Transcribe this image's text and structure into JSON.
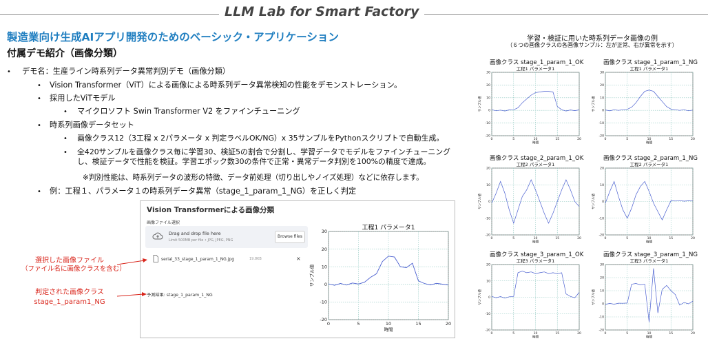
{
  "header": {
    "title": "LLM Lab for Smart Factory"
  },
  "main_title": "製造業向け生成AIアプリ開発のためのベーシック・アプリケーション",
  "sub_title": "付属デモ紹介（画像分類）",
  "bullets": {
    "demo": "デモ名：生産ライン時系列データ異常判別デモ（画像分類）",
    "vit": "Vision Transformer（ViT）による画像による時系列データ異常検知の性能をデモンストレーション。",
    "model_head": "採用したViTモデル",
    "model": "マイクロソフト Swin Transformer V2 をファインチューニング",
    "dataset_head": "時系列画像データセット",
    "classes": "画像クラス12（3工程 x 2パラメータ x 判定ラベルOK/NG）x 35サンプルをPythonスクリプトで自動生成。",
    "train1": "全420サンプルを画像クラス毎に学習30、検証5の割合で分割し、学習データでモデルをファインチューニング",
    "train2": "し、検証データで性能を検証。学習エポック数30の条件で正常・異常データ判別を100%の精度で達成。",
    "note": "※判別性能は、時系列データの波形の特徴、データ前処理（切り出しやノイズ処理）などに依存します。",
    "example": "例：工程１、パラメータ１の時系列データ異常（stage_1_param_1_NG）を正しく判定"
  },
  "app": {
    "title": "Vision Transformerによる画像分類",
    "upload_label": "画像ファイル選択",
    "drop_main": "Drag and drop file here",
    "drop_sub": "Limit 500MB per file • JPG, JPEG, PNG",
    "browse": "Browse files",
    "file_name": "serial_33_stage_1_param_1_NG.jpg",
    "file_size": "19.8KB",
    "close": "×",
    "prediction": "予測結果: stage_1_param_1_NG"
  },
  "annotations": {
    "file_line1": "選択した画像ファイル",
    "file_line2": "（ファイル名に画像クラスを含む）",
    "class_line1": "判定された画像クラス",
    "class_line2": "stage_1_param1_NG"
  },
  "right_panel": {
    "title": "学習・検証に用いた時系列データ画像の例",
    "subtitle": "（６つの画像クラスの各画像サンプル：左が正常、右が異常を示す）"
  },
  "chart_data": [
    {
      "type": "line",
      "label": "",
      "title": "工程1 パラメータ1",
      "xlabel": "時間",
      "ylabel": "サンプル値",
      "xlim": [
        0,
        20
      ],
      "ylim": [
        -20,
        30
      ],
      "xticks": [
        0,
        5,
        10,
        15,
        20
      ],
      "yticks": [
        -20,
        -10,
        0,
        10,
        20,
        30
      ],
      "grid": true,
      "x": [
        0,
        1,
        2,
        3,
        4,
        5,
        6,
        7,
        8,
        9,
        10,
        11,
        12,
        13,
        14,
        15,
        16,
        17,
        18,
        19,
        20
      ],
      "values": [
        0.3,
        -0.5,
        0.5,
        -0.4,
        0.8,
        0.2,
        1.2,
        4,
        6,
        13,
        16,
        15.5,
        10,
        9.5,
        12,
        2,
        0.5,
        -0.3,
        0.6,
        0.1,
        -0.4
      ]
    },
    {
      "type": "line",
      "label": "画像クラス stage_1_param_1_OK",
      "title": "工程1 パラメータ1",
      "xlabel": "時間",
      "ylabel": "サンプル値",
      "xlim": [
        0,
        20
      ],
      "ylim": [
        -20,
        30
      ],
      "xticks": [
        0,
        5,
        10,
        15,
        20
      ],
      "yticks": [
        -20,
        -10,
        0,
        10,
        20,
        30
      ],
      "grid": true,
      "x": [
        0,
        1,
        2,
        3,
        4,
        5,
        6,
        7,
        8,
        9,
        10,
        11,
        12,
        13,
        14,
        15,
        16,
        17,
        18,
        19,
        20
      ],
      "values": [
        0.5,
        -0.3,
        0.2,
        -0.5,
        0.4,
        0.5,
        2,
        6,
        9,
        12,
        14,
        14.5,
        15,
        15,
        14.5,
        3,
        0.5,
        -0.5,
        0.3,
        -0.2,
        0.4
      ]
    },
    {
      "type": "line",
      "label": "画像クラス stage_1_param_1_NG",
      "title": "工程1 パラメータ1",
      "xlabel": "時間",
      "ylabel": "サンプル値",
      "xlim": [
        0,
        20
      ],
      "ylim": [
        -20,
        30
      ],
      "xticks": [
        0,
        5,
        10,
        15,
        20
      ],
      "yticks": [
        -20,
        -10,
        0,
        10,
        20,
        30
      ],
      "grid": true,
      "x": [
        0,
        1,
        2,
        3,
        4,
        5,
        6,
        7,
        8,
        9,
        10,
        11,
        12,
        13,
        14,
        15,
        16,
        17,
        18,
        19,
        20
      ],
      "values": [
        0.3,
        -0.4,
        0.5,
        0,
        0.5,
        0.8,
        2.5,
        6,
        11,
        15,
        16,
        15,
        11,
        7,
        3,
        1,
        0.5,
        0,
        0.5,
        -0.3,
        0.2
      ]
    },
    {
      "type": "line",
      "label": "画像クラス stage_2_param_1_OK",
      "title": "工程2 パラメータ1",
      "xlabel": "時間",
      "ylabel": "サンプル値",
      "xlim": [
        0,
        20
      ],
      "ylim": [
        -20,
        20
      ],
      "xticks": [
        0,
        5,
        10,
        15,
        20
      ],
      "yticks": [
        -20,
        -10,
        0,
        10,
        20
      ],
      "grid": true,
      "x": [
        0,
        1,
        2,
        3,
        4,
        5,
        6,
        7,
        8,
        9,
        10,
        11,
        12,
        13,
        14,
        15,
        16,
        17,
        18,
        19,
        20
      ],
      "values": [
        -1,
        5,
        12,
        5,
        -5,
        -13,
        -5,
        3,
        7,
        13,
        7,
        0,
        -7,
        -13,
        -7,
        0,
        7,
        13,
        7,
        0,
        -3
      ]
    },
    {
      "type": "line",
      "label": "画像クラス stage_2_param_1_NG",
      "title": "工程2 パラメータ1",
      "xlabel": "時間",
      "ylabel": "サンプル値",
      "xlim": [
        0,
        20
      ],
      "ylim": [
        -20,
        20
      ],
      "xticks": [
        0,
        5,
        10,
        15,
        20
      ],
      "yticks": [
        -20,
        -10,
        0,
        10,
        20
      ],
      "grid": true,
      "x": [
        0,
        1,
        2,
        3,
        4,
        5,
        6,
        7,
        8,
        9,
        10,
        11,
        12,
        13,
        14,
        15,
        16,
        17,
        18,
        19,
        20
      ],
      "values": [
        -1,
        6,
        12,
        3,
        -5,
        -10,
        -4,
        4,
        9,
        12,
        6,
        -1,
        -6,
        -11,
        -5,
        0.5,
        0.3,
        0.5,
        0.2,
        0.4,
        0.3
      ]
    },
    {
      "type": "line",
      "label": "画像クラス stage_3_param_1_OK",
      "title": "工程3 パラメータ1",
      "xlabel": "時間",
      "ylabel": "サンプル値",
      "xlim": [
        0,
        20
      ],
      "ylim": [
        -20,
        20
      ],
      "xticks": [
        0,
        5,
        10,
        15,
        20
      ],
      "yticks": [
        -20,
        -10,
        0,
        10,
        20
      ],
      "grid": true,
      "x": [
        0,
        1,
        2,
        3,
        4,
        5,
        6,
        7,
        8,
        9,
        10,
        11,
        12,
        13,
        14,
        15,
        16,
        17,
        18,
        19,
        20
      ],
      "values": [
        0.5,
        -0.3,
        0.4,
        -0.5,
        0.3,
        0.5,
        15,
        16,
        15,
        15.5,
        14.5,
        15,
        15.5,
        14.5,
        15,
        14.5,
        15,
        2,
        0.5,
        -0.3,
        3
      ]
    },
    {
      "type": "line",
      "label": "画像クラス stage_3_param_1_NG",
      "title": "工程3 パラメータ1",
      "xlabel": "時間",
      "ylabel": "サンプル値",
      "xlim": [
        0,
        20
      ],
      "ylim": [
        -20,
        30
      ],
      "xticks": [
        0,
        5,
        10,
        15,
        20
      ],
      "yticks": [
        -20,
        -10,
        0,
        10,
        20,
        30
      ],
      "grid": true,
      "x": [
        0,
        1,
        2,
        3,
        4,
        5,
        6,
        7,
        8,
        9,
        10,
        11,
        12,
        13,
        14,
        15,
        16,
        17,
        18,
        19,
        20
      ],
      "values": [
        -0.5,
        0.3,
        -0.3,
        0.5,
        0.4,
        0.6,
        15,
        15.5,
        14.5,
        15,
        -14,
        27,
        -7,
        11,
        14,
        10,
        7,
        -1,
        1,
        0,
        2
      ]
    }
  ]
}
